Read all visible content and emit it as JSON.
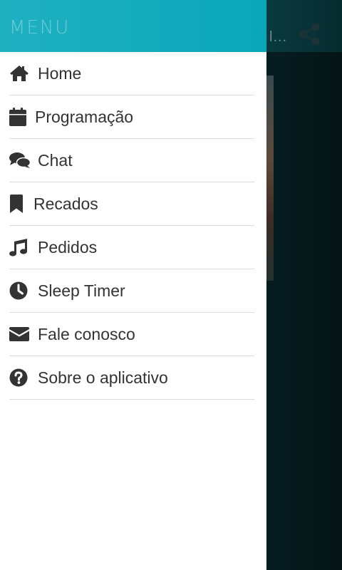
{
  "background": {
    "title_fragment": "l..."
  },
  "drawer": {
    "title": "MENU",
    "items": [
      {
        "label": "Home",
        "icon": "home-icon"
      },
      {
        "label": "Programação",
        "icon": "calendar-icon"
      },
      {
        "label": "Chat",
        "icon": "chat-icon"
      },
      {
        "label": "Recados",
        "icon": "bookmark-icon"
      },
      {
        "label": "Pedidos",
        "icon": "music-icon"
      },
      {
        "label": "Sleep Timer",
        "icon": "clock-icon"
      },
      {
        "label": "Fale conosco",
        "icon": "envelope-icon"
      },
      {
        "label": "Sobre o aplicativo",
        "icon": "question-circle-icon"
      }
    ]
  },
  "colors": {
    "header_accent": "#0aa7bb",
    "text": "#333333",
    "divider": "#dcdcdc"
  }
}
